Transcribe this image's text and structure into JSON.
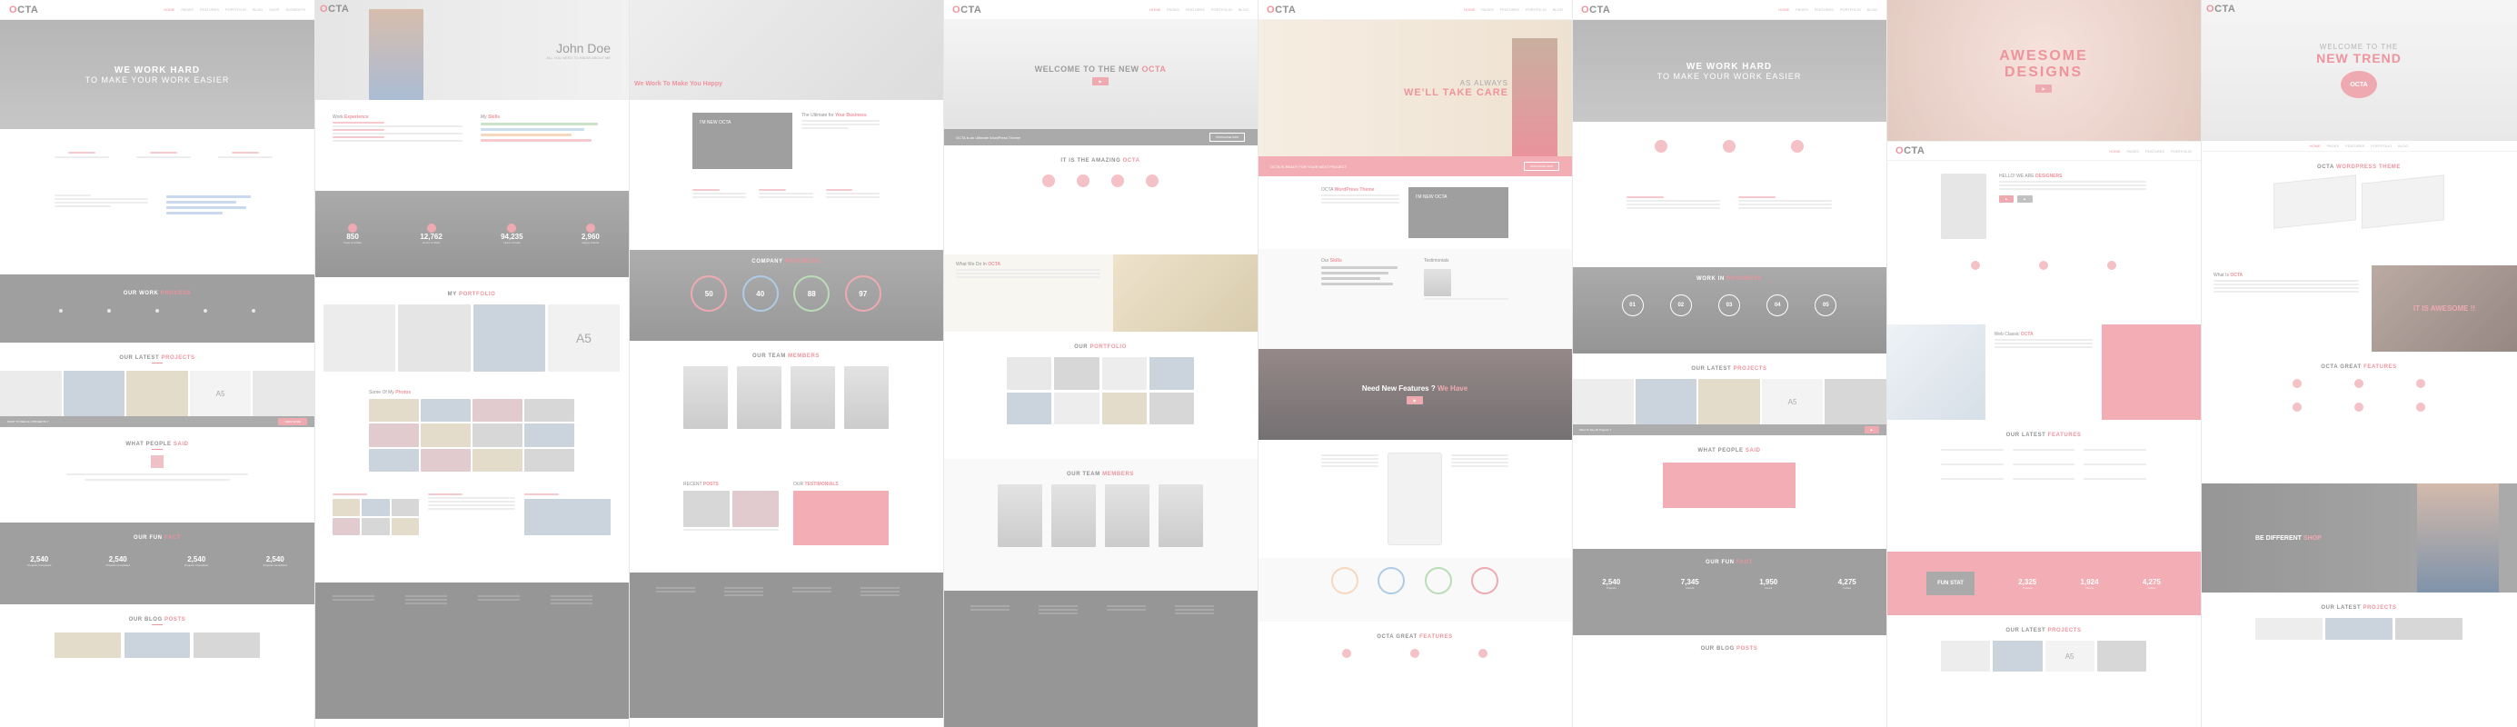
{
  "brand": {
    "logo_prefix": "O",
    "logo_rest": "CTA",
    "accent": "#e86b78",
    "dark": "#7a7a7a"
  },
  "nav_items": [
    "Home",
    "Pages",
    "Features",
    "Portfolio",
    "Blog",
    "Shop",
    "Elements",
    "Contact"
  ],
  "panel1": {
    "hero_line1": "WE WORK HARD",
    "hero_line2": "TO MAKE YOUR WORK EASIER",
    "work_process_title": "OUR WORK",
    "work_process_accent": "PROCESS",
    "projects_title": "OUR LATEST",
    "projects_accent": "PROJECTS",
    "project_tag": "A5",
    "cta_text": "WANT TO SEE ALL PROJECTS ?",
    "cta_button": "VIEW MORE",
    "testimonial_title": "WHAT PEOPLE",
    "testimonial_accent": "SAID",
    "funfact_title": "OUR FUN",
    "funfact_accent": "FACT",
    "stats": [
      {
        "n": "2,540",
        "l": "Projects Completed"
      },
      {
        "n": "2,540",
        "l": "Projects Completed"
      },
      {
        "n": "2,540",
        "l": "Projects Completed"
      },
      {
        "n": "2,540",
        "l": "Projects Completed"
      }
    ],
    "blog_title": "OUR BLOG",
    "blog_accent": "POSTS"
  },
  "panel2": {
    "name": "John Doe",
    "tagline": "ALL YOU NEED TO KNOW ABOUT ME",
    "col1_title": "Work",
    "col1_accent": "Experience",
    "col2_title": "My",
    "col2_accent": "Skills",
    "stats": [
      {
        "n": "850",
        "l": "Cups of Coffee"
      },
      {
        "n": "12,762",
        "l": "Hours of Work"
      },
      {
        "n": "94,235",
        "l": "Lines of Code"
      },
      {
        "n": "2,960",
        "l": "Happy Clients"
      }
    ],
    "portfolio_title": "MY",
    "portfolio_accent": "PORTFOLIO",
    "project_tag": "A5",
    "photos_title": "Some Of My",
    "photos_accent": "Photos"
  },
  "panel3": {
    "hero": "We Work To Make You Happy",
    "intro_title": "The Ultimate for",
    "intro_accent": "Your Business",
    "new_octa_badge": "I'M NEW OCTA",
    "company_title": "COMPANY",
    "company_accent": "PROGRESS",
    "rings": [
      "50",
      "40",
      "88",
      "97"
    ],
    "team_title": "OUR TEAM",
    "team_accent": "MEMBERS",
    "recent_title": "RECENT",
    "recent_accent": "POSTS",
    "testi_title": "OUR",
    "testi_accent": "TESTIMONIALS"
  },
  "panel4": {
    "hero_title": "WELCOME TO THE NEW",
    "hero_accent": "OCTA",
    "about_text": "OCTA is an Ultimate WordPress Theme!",
    "about_button": "PURCHASE NOW",
    "amazing_title": "IT IS THE AMAZING",
    "amazing_accent": "OCTA",
    "what_title": "What We Do In",
    "what_accent": "OCTA",
    "portfolio_title": "OUR",
    "portfolio_accent": "PORTFOLIO",
    "team_title": "OUR TEAM",
    "team_accent": "MEMBERS"
  },
  "panel5": {
    "hero_line1": "AS ALWAYS",
    "hero_line2": "WE'LL TAKE CARE",
    "banner": "OCTA IS READY FOR YOUR NEXT PROJECT",
    "banner_button": "PURCHASE NOW",
    "wp_title": "OCTA",
    "wp_accent": "WordPress Theme",
    "new_octa_badge": "I'M NEW OCTA",
    "skills_title": "Our",
    "skills_accent": "Skills",
    "testi_title": "Testimonials",
    "features_q": "Need New Features ?",
    "features_accent": "We Have",
    "features_title": "OCTA GREAT",
    "features_accent2": "FEATURES"
  },
  "panel6": {
    "hero_line1": "WE WORK HARD",
    "hero_line2": "TO MAKE YOUR WORK EASIER",
    "process_title": "WORK IN",
    "process_accent": "PROGRESS",
    "steps": [
      "01",
      "02",
      "03",
      "04",
      "05"
    ],
    "projects_title": "OUR LATEST",
    "projects_accent": "PROJECTS",
    "project_tag": "A5",
    "cta_text": "Want To See All Projects ?",
    "people_title": "WHAT PEOPLE",
    "people_accent": "SAID",
    "fact_title": "OUR FUN",
    "fact_accent": "FACT",
    "stats": [
      {
        "n": "2,540",
        "l": "Projects"
      },
      {
        "n": "7,345",
        "l": "Clients"
      },
      {
        "n": "1,950",
        "l": "Hours"
      },
      {
        "n": "4,275",
        "l": "Coffee"
      }
    ],
    "blog_title": "OUR BLOG",
    "blog_accent": "POSTS"
  },
  "panel7": {
    "hero_line1": "AWESOME",
    "hero_line2": "DESIGNS",
    "hello_title": "HELLO! WE ARE",
    "hello_accent": "DESIGNERS",
    "web_title": "Web Classic",
    "web_accent": "OCTA",
    "latest_title": "OUR LATEST",
    "latest_accent": "FEATURES",
    "funstat_title": "FUN STAT",
    "stats": [
      {
        "n": "2,325",
        "l": "Projects"
      },
      {
        "n": "1,924",
        "l": "Clients"
      },
      {
        "n": "4,275",
        "l": "Coffee"
      }
    ],
    "latest2_title": "OUR LATEST",
    "latest2_accent": "PROJECTS",
    "project_tag": "A5"
  },
  "panel8": {
    "hero_line1": "WELCOME TO THE",
    "hero_line2": "NEW TREND",
    "hero_logo": "OCTA",
    "theme_title": "OCTA",
    "theme_accent": "WORDPRESS THEME",
    "what_title": "What Is",
    "what_accent": "OCTA",
    "awesome": "IT IS AWESOME !!",
    "features_title": "OCTA GREAT",
    "features_accent": "FEATURES",
    "cta_title": "BE DIFFERENT",
    "cta_accent": "SHOP",
    "latest_title": "OUR LATEST",
    "latest_accent": "PROJECTS"
  }
}
